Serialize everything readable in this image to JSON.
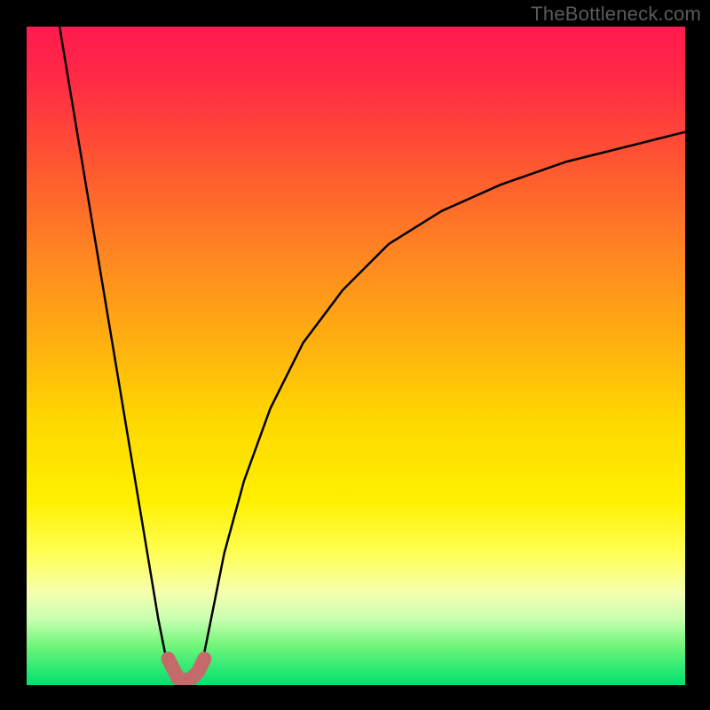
{
  "watermark": "TheBottleneck.com",
  "chart_data": {
    "type": "line",
    "title": "",
    "xlabel": "",
    "ylabel": "",
    "xlim": [
      0,
      100
    ],
    "ylim": [
      0,
      100
    ],
    "grid": false,
    "series": [
      {
        "name": "bottleneck-curve",
        "x": [
          5,
          7,
          10,
          13,
          16,
          18,
          20,
          21,
          22,
          23,
          24,
          25,
          26,
          27,
          28,
          30,
          33,
          37,
          42,
          48,
          55,
          63,
          72,
          82,
          92,
          100
        ],
        "values": [
          100,
          88,
          70,
          52,
          34,
          22,
          10,
          5,
          2,
          1,
          0.8,
          1,
          2,
          5,
          10,
          20,
          31,
          42,
          52,
          60,
          67,
          72,
          76,
          79.5,
          82,
          84
        ]
      }
    ],
    "highlight": {
      "name": "bottleneck-min-marker",
      "color": "#c46a6a",
      "x": [
        21.5,
        22.5,
        23,
        23.5,
        24,
        24.5,
        25,
        26,
        27
      ],
      "values": [
        4,
        2,
        1,
        0.8,
        0.8,
        0.8,
        1,
        2,
        4
      ]
    },
    "colors": {
      "curve": "#000000",
      "marker": "#c46a6a",
      "gradient_top": "#ff1a50",
      "gradient_mid": "#ffd800",
      "gradient_bottom": "#00e070"
    }
  }
}
